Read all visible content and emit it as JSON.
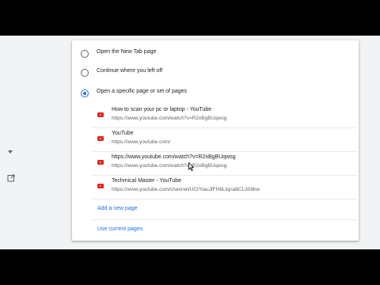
{
  "startup": {
    "options": [
      {
        "label": "Open the New Tab page",
        "selected": false
      },
      {
        "label": "Continue where you left off",
        "selected": false
      },
      {
        "label": "Open a specific page or set of pages",
        "selected": true
      }
    ]
  },
  "pages": [
    {
      "title": "How to scan your pc or laptop - YouTube",
      "url": "https://www.youtube.com/watch?v=R2xBgBUqwsg"
    },
    {
      "title": "YouTube",
      "url": "https://www.youtube.com/"
    },
    {
      "title": "https://www.youtube.com/watch?v=R2xBgBUqwsg",
      "url": "https://www.youtube.com/watch?v=R2xBgBUqwsg"
    },
    {
      "title": "Techmical Master - YouTube",
      "url": "https://www.youtube.com/channel/UCtYiauJfFH6Ltqna8CL308kw"
    }
  ],
  "actions": {
    "add_new_page": "Add a new page",
    "use_current_pages": "Use current pages"
  },
  "icons": {
    "favicon": "youtube-icon",
    "menu": "more-vert-icon"
  },
  "colors": {
    "accent": "#1a73e8",
    "youtube_red": "#e62117",
    "letterbox": "#000000"
  }
}
